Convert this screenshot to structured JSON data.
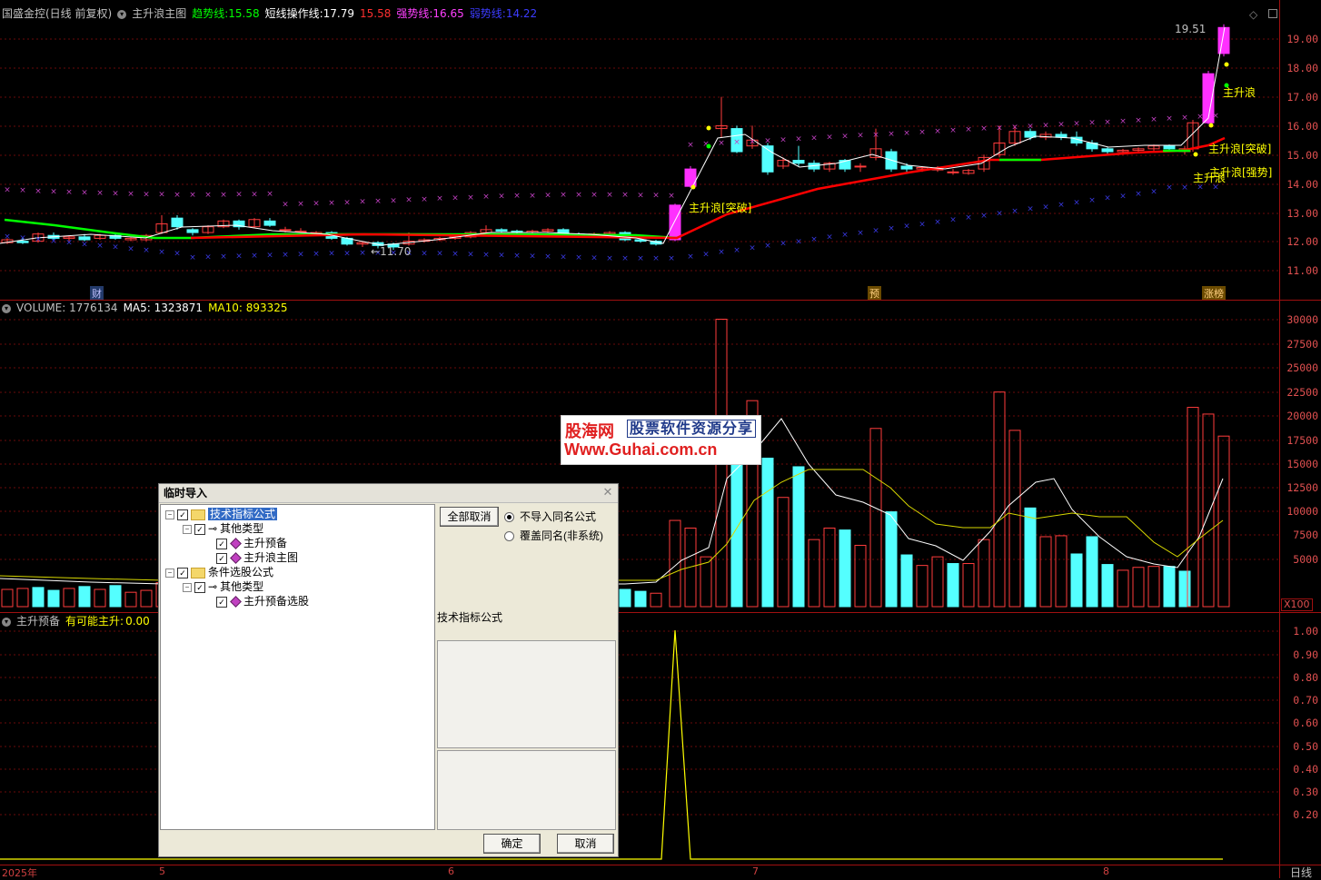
{
  "main_header": {
    "stock": "国盛金控(日线 前复权)",
    "indicator": "主升浪主图",
    "trend_label": "趋势线:",
    "trend_value": "15.58",
    "short_label": "短线操作线:",
    "short_value": "17.79",
    "red_value": "15.58",
    "strong_label": "强势线:",
    "strong_value": "16.65",
    "weak_label": "弱势线:",
    "weak_value": "14.22"
  },
  "price_axis": [
    "19.00",
    "18.00",
    "17.00",
    "16.00",
    "15.00",
    "14.00",
    "13.00",
    "12.00",
    "11.00"
  ],
  "price_annotations": {
    "high": "19.51",
    "low": "11.70",
    "signal_breakout_1": "主升浪[突破]",
    "signal_main": "主升浪",
    "signal_breakout_2": "主升浪[突破]",
    "signal_strong": "主升浪[强势]",
    "signal_main_2": "主升浪",
    "tag_cai": "财",
    "tag_yu": "预",
    "tag_zhangting": "涨榜"
  },
  "volume_header": {
    "label": "VOLUME: 1776134",
    "ma5": "MA5: 1323871",
    "ma10": "MA10: 893325"
  },
  "volume_axis": [
    "30000",
    "27500",
    "25000",
    "22500",
    "20000",
    "17500",
    "15000",
    "12500",
    "10000",
    "7500",
    "5000"
  ],
  "volume_unit": "X100",
  "sub_header": {
    "name": "主升预备",
    "label": "有可能主升:",
    "value": "0.00"
  },
  "sub_axis": [
    "1.00",
    "0.90",
    "0.80",
    "0.70",
    "0.60",
    "0.50",
    "0.40",
    "0.30",
    "0.20"
  ],
  "x_axis": [
    "2025年",
    "5",
    "6",
    "7",
    "8"
  ],
  "period": "日线",
  "dialog": {
    "title": "临时导入",
    "tree": [
      {
        "label": "技术指标公式"
      },
      {
        "label": "其他类型"
      },
      {
        "label": "主升预备"
      },
      {
        "label": "主升浪主图"
      },
      {
        "label": "条件选股公式"
      },
      {
        "label": "其他类型"
      },
      {
        "label": "主升预备选股"
      }
    ],
    "cancel_all": "全部取消",
    "radio_skip": "不导入同名公式",
    "radio_overwrite": "覆盖同名(非系统)",
    "type_label": "技术指标公式",
    "ok": "确定",
    "cancel": "取消"
  },
  "watermark": {
    "brand": "股海网",
    "slogan": "股票软件资源分享",
    "url": "Www.Guhai.com.cn"
  },
  "colors": {
    "bg": "#000000",
    "up": "#ff3c3c",
    "down": "#54ffff",
    "trend": "#00ff00",
    "short": "#ffffff",
    "red_line": "#ff0000",
    "strong": "#ff00ff",
    "weak": "#4040ff",
    "grid": "#a01010",
    "yellow": "#ffff00"
  }
}
